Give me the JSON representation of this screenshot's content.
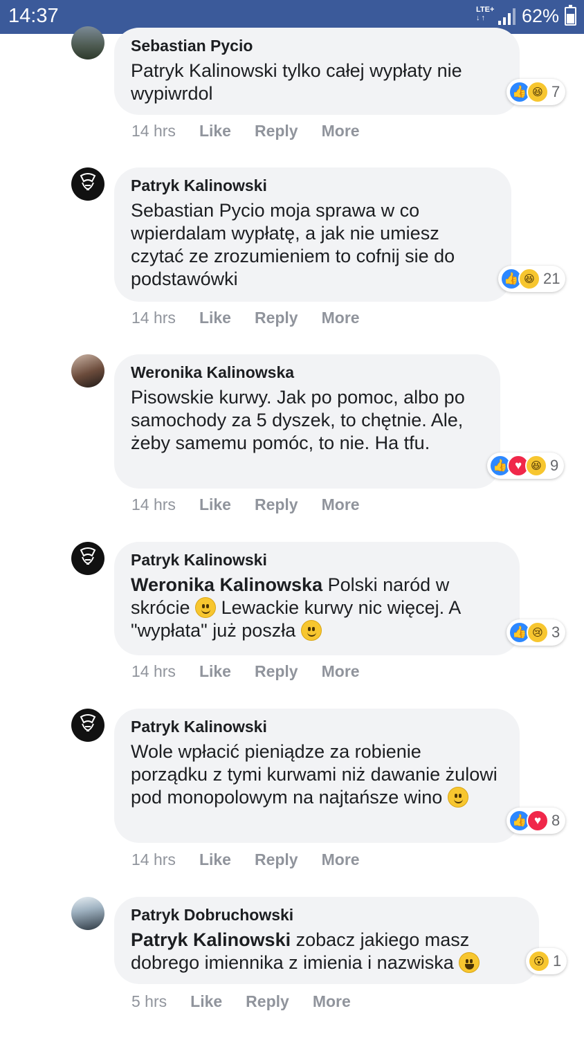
{
  "status": {
    "time": "14:37",
    "network": "LTE+",
    "network_arrows": "↓↑",
    "battery": "62%"
  },
  "comments": [
    {
      "author": "Sebastian Pycio",
      "mention": "",
      "text": "Patryk Kalinowski tylko całej wypłaty nie wypiwrdol",
      "reaction_icons": [
        "like-icon",
        "haha-icon"
      ],
      "reaction_count": "7",
      "time": "14 hrs"
    },
    {
      "author": "Patryk Kalinowski",
      "mention": "",
      "text": "Sebastian Pycio moja sprawa w co wpierdalam wypłatę, a jak nie umiesz czytać ze zrozumieniem to cofnij sie do podstawówki",
      "reaction_icons": [
        "like-icon",
        "haha-icon"
      ],
      "reaction_count": "21",
      "time": "14 hrs"
    },
    {
      "author": "Weronika Kalinowska",
      "mention": "",
      "text": "Pisowskie kurwy. Jak po pomoc, albo po samochody za 5 dyszek, to chętnie. Ale, żeby samemu pomóc, to nie. Ha tfu.",
      "reaction_icons": [
        "like-icon",
        "love-icon",
        "haha-icon"
      ],
      "reaction_count": "9",
      "time": "14 hrs"
    },
    {
      "author": "Patryk Kalinowski",
      "mention": "Weronika Kalinowska",
      "text_part1": "Polski naród w skrócie",
      "text_part2": "Lewackie kurwy nic więcej. A \"wypłata\" już poszła",
      "reaction_icons": [
        "like-icon",
        "sad-icon"
      ],
      "reaction_count": "3",
      "time": "14 hrs"
    },
    {
      "author": "Patryk Kalinowski",
      "mention": "",
      "text": "Wole wpłacić pieniądze za robienie porządku z tymi kurwami niż dawanie żulowi pod monopolowym na najtańsze wino",
      "reaction_icons": [
        "like-icon",
        "love-icon"
      ],
      "reaction_count": "8",
      "time": "14 hrs"
    },
    {
      "author": "Patryk Dobruchowski",
      "mention": "Patryk Kalinowski",
      "text": "zobacz jakiego masz dobrego imiennika z imienia i nazwiska",
      "reaction_icons": [
        "wow-icon"
      ],
      "reaction_count": "1",
      "time": "5 hrs"
    }
  ],
  "actions": {
    "like": "Like",
    "reply": "Reply",
    "more": "More"
  },
  "colors": {
    "header": "#3b5a9a",
    "bubble": "#f2f3f5",
    "meta": "#90949c",
    "like": "#2d88ff",
    "love": "#f0284a"
  }
}
